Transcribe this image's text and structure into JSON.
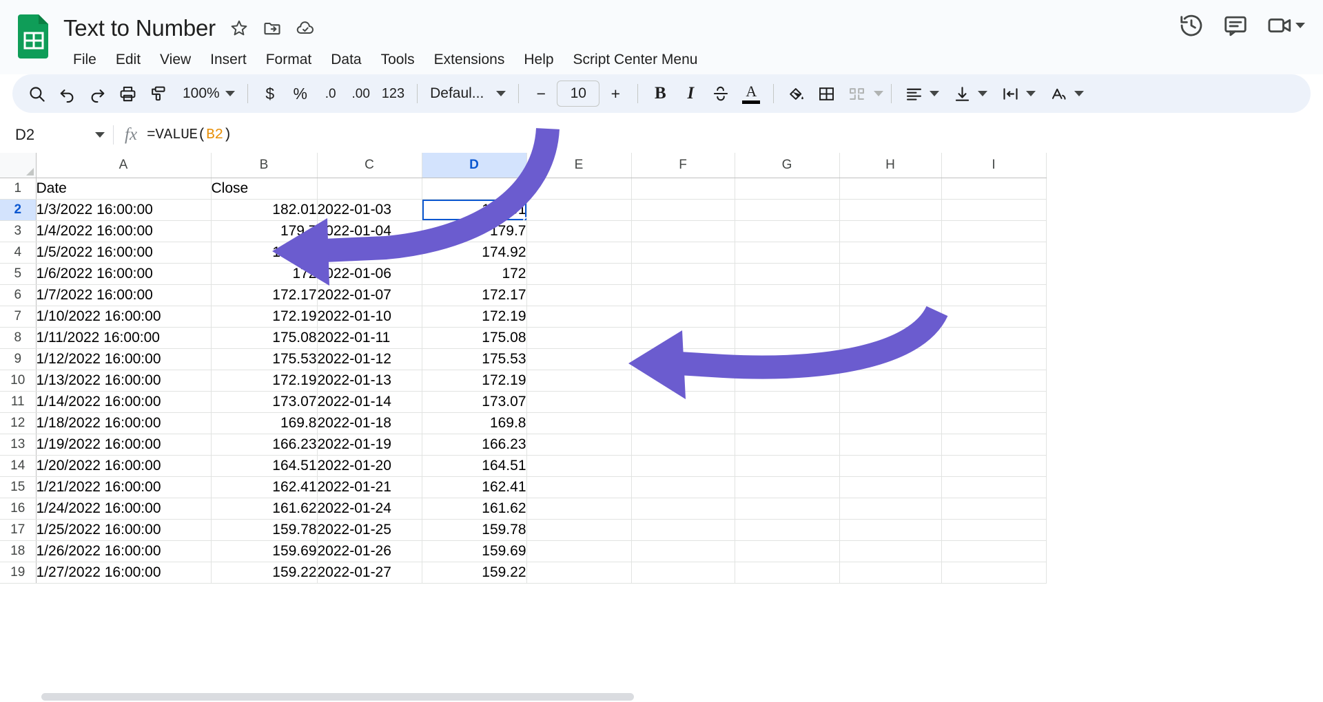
{
  "header": {
    "doc_title": "Text to Number",
    "app_icon": "sheets-icon",
    "title_icons": [
      {
        "name": "star-icon",
        "label": "Star"
      },
      {
        "name": "move-to-folder-icon",
        "label": "Move"
      },
      {
        "name": "cloud-saved-icon",
        "label": "Saved to Drive"
      }
    ],
    "menus": [
      "File",
      "Edit",
      "View",
      "Insert",
      "Format",
      "Data",
      "Tools",
      "Extensions",
      "Help",
      "Script Center Menu"
    ],
    "right_icons": [
      {
        "name": "version-history-icon",
        "label": "Last edit"
      },
      {
        "name": "comment-icon",
        "label": "Open comment history"
      },
      {
        "name": "meet-camera-icon",
        "label": "Join a call"
      }
    ]
  },
  "toolbar": {
    "search_label": "Search",
    "undo_label": "Undo",
    "redo_label": "Redo",
    "print_label": "Print",
    "paint_format_label": "Paint format",
    "zoom_value": "100%",
    "currency_label": "$",
    "percent_label": "%",
    "decimal_decrease_label": ".0",
    "decimal_increase_label": ".00",
    "number_format_label": "123",
    "font_name": "Defaul...",
    "font_decrease_label": "−",
    "font_size": "10",
    "font_increase_label": "+",
    "bold_label": "B",
    "italic_label": "I",
    "strikethrough_label": "S",
    "text_color_label": "A",
    "fill_color_label": "Fill color",
    "borders_label": "Borders",
    "merge_label": "Merge cells",
    "halign_label": "Horizontal align",
    "valign_label": "Vertical align",
    "wrap_label": "Text wrapping",
    "rotate_label": "Text rotation"
  },
  "formula_bar": {
    "name_box": "D2",
    "fx_label": "fx",
    "formula_prefix": "=VALUE(",
    "formula_ref": "B2",
    "formula_suffix": ")"
  },
  "grid": {
    "columns": [
      "A",
      "B",
      "C",
      "D",
      "E",
      "F",
      "G",
      "H",
      "I"
    ],
    "active_column": "D",
    "active_row": "2",
    "selected_cell": "D2",
    "rows": [
      {
        "n": "1",
        "A": "Date",
        "B": "Close",
        "C": "",
        "D": ""
      },
      {
        "n": "2",
        "A": "1/3/2022 16:00:00",
        "B": "182.01",
        "C": "2022-01-03",
        "D": "182.01"
      },
      {
        "n": "3",
        "A": "1/4/2022 16:00:00",
        "B": "179.7",
        "C": "2022-01-04",
        "D": "179.7"
      },
      {
        "n": "4",
        "A": "1/5/2022 16:00:00",
        "B": "174.92",
        "C": "2022-01-05",
        "D": "174.92"
      },
      {
        "n": "5",
        "A": "1/6/2022 16:00:00",
        "B": "172",
        "C": "2022-01-06",
        "D": "172"
      },
      {
        "n": "6",
        "A": "1/7/2022 16:00:00",
        "B": "172.17",
        "C": "2022-01-07",
        "D": "172.17"
      },
      {
        "n": "7",
        "A": "1/10/2022 16:00:00",
        "B": "172.19",
        "C": "2022-01-10",
        "D": "172.19"
      },
      {
        "n": "8",
        "A": "1/11/2022 16:00:00",
        "B": "175.08",
        "C": "2022-01-11",
        "D": "175.08"
      },
      {
        "n": "9",
        "A": "1/12/2022 16:00:00",
        "B": "175.53",
        "C": "2022-01-12",
        "D": "175.53"
      },
      {
        "n": "10",
        "A": "1/13/2022 16:00:00",
        "B": "172.19",
        "C": "2022-01-13",
        "D": "172.19"
      },
      {
        "n": "11",
        "A": "1/14/2022 16:00:00",
        "B": "173.07",
        "C": "2022-01-14",
        "D": "173.07"
      },
      {
        "n": "12",
        "A": "1/18/2022 16:00:00",
        "B": "169.8",
        "C": "2022-01-18",
        "D": "169.8"
      },
      {
        "n": "13",
        "A": "1/19/2022 16:00:00",
        "B": "166.23",
        "C": "2022-01-19",
        "D": "166.23"
      },
      {
        "n": "14",
        "A": "1/20/2022 16:00:00",
        "B": "164.51",
        "C": "2022-01-20",
        "D": "164.51"
      },
      {
        "n": "15",
        "A": "1/21/2022 16:00:00",
        "B": "162.41",
        "C": "2022-01-21",
        "D": "162.41"
      },
      {
        "n": "16",
        "A": "1/24/2022 16:00:00",
        "B": "161.62",
        "C": "2022-01-24",
        "D": "161.62"
      },
      {
        "n": "17",
        "A": "1/25/2022 16:00:00",
        "B": "159.78",
        "C": "2022-01-25",
        "D": "159.78"
      },
      {
        "n": "18",
        "A": "1/26/2022 16:00:00",
        "B": "159.69",
        "C": "2022-01-26",
        "D": "159.69"
      },
      {
        "n": "19",
        "A": "1/27/2022 16:00:00",
        "B": "159.22",
        "C": "2022-01-27",
        "D": "159.22"
      }
    ]
  },
  "annotations": {
    "arrow_color": "#6b5ccf",
    "arrows": [
      {
        "name": "arrow-to-number-format",
        "points_to": "number-format-toolbar"
      },
      {
        "name": "arrow-to-converted-values",
        "points_to": "column-d-values"
      }
    ]
  }
}
